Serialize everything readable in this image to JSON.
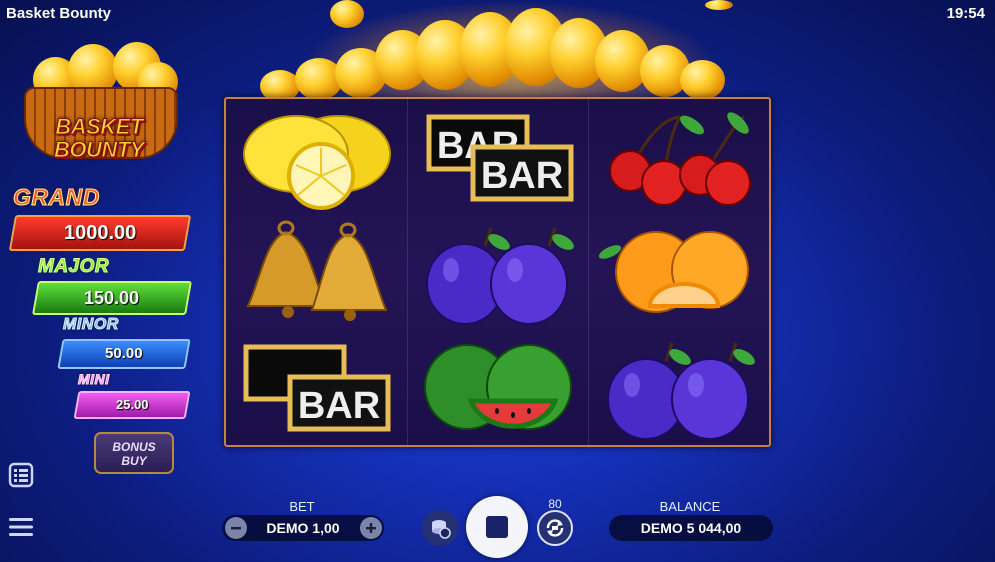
{
  "status_bar": {
    "app_title": "Basket Bounty",
    "clock": "19:54"
  },
  "logo": {
    "line1": "BASKET",
    "line2": "BOUNTY"
  },
  "jackpots": [
    {
      "name": "GRAND",
      "value": "1000.00",
      "color": "#d8231f"
    },
    {
      "name": "MAJOR",
      "value": "150.00",
      "color": "#2fa81c"
    },
    {
      "name": "MINOR",
      "value": "50.00",
      "color": "#1f6ee0"
    },
    {
      "name": "MINI",
      "value": "25.00",
      "color": "#d52dd6"
    }
  ],
  "bonus_buy": {
    "line1": "BONUS",
    "line2": "BUY"
  },
  "reels": {
    "columns": [
      [
        "lemon",
        "bell",
        "bar"
      ],
      [
        "bar",
        "plum",
        "watermelon"
      ],
      [
        "cherry",
        "orange",
        "plum"
      ]
    ],
    "bar_text": "BAR"
  },
  "bottom": {
    "bet_label": "BET",
    "bet_value": "DEMO 1,00",
    "autoplay_count": "80",
    "balance_label": "BALANCE",
    "balance_value": "DEMO 5 044,00"
  },
  "icons": {
    "paytable": "paytable-icon",
    "menu": "hamburger-menu-icon",
    "minus": "minus-icon",
    "plus": "plus-icon",
    "coins": "coin-settings-icon",
    "stop": "stop-icon",
    "autoplay": "autoplay-icon"
  }
}
